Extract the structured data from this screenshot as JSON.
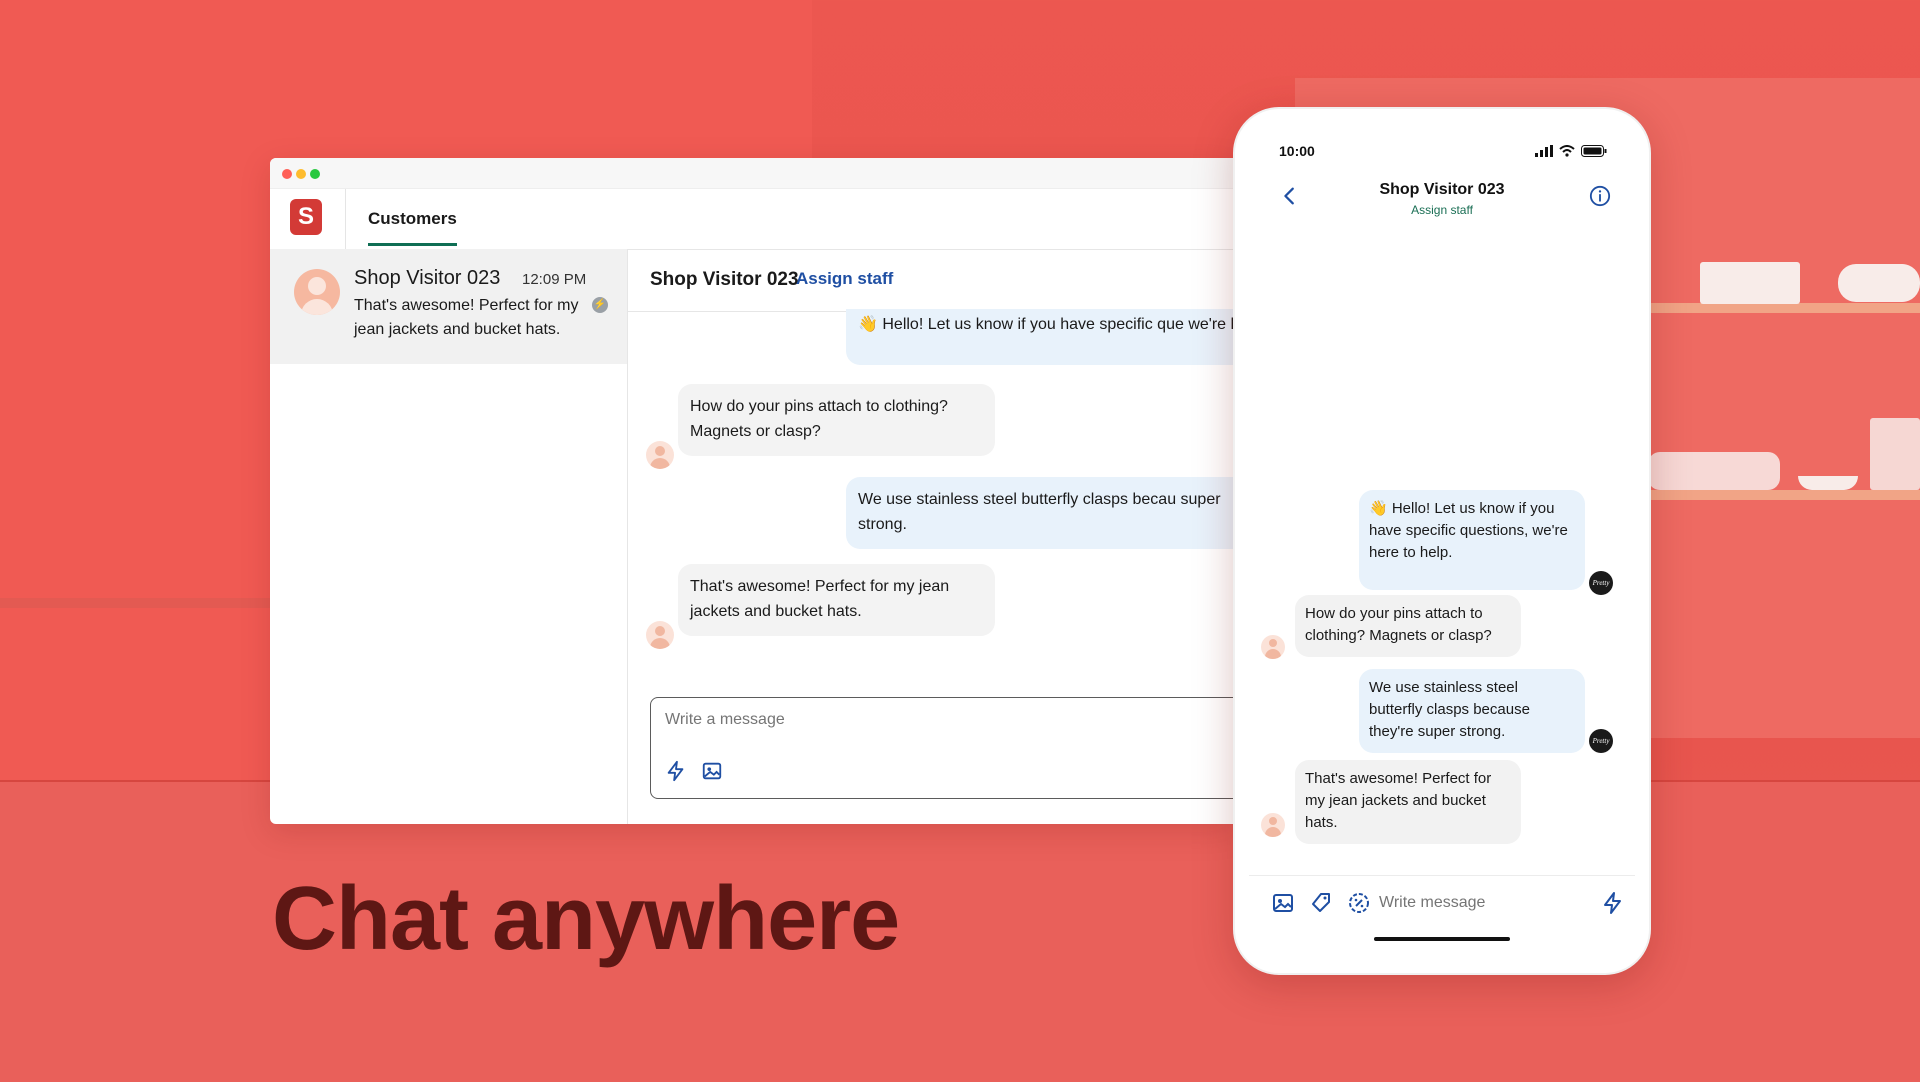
{
  "desktop": {
    "tab_label": "Customers",
    "logo_letter": "S",
    "conversation": {
      "name": "Shop Visitor 023",
      "time": "12:09 PM",
      "preview": "That's awesome! Perfect for my jean jackets and bucket hats."
    },
    "chat": {
      "title": "Shop Visitor 023",
      "assign_label": "Assign staff",
      "messages": [
        {
          "from": "shop",
          "text": "👋 Hello! Let us know if you have specific que we're here to help."
        },
        {
          "from": "visitor",
          "text": "How do your pins attach to clothing? Magnets or clasp?"
        },
        {
          "from": "shop",
          "text": "We use stainless steel butterfly clasps becau super strong."
        },
        {
          "from": "visitor",
          "text": "That's awesome! Perfect for my jean jackets and bucket hats."
        }
      ],
      "composer_placeholder": "Write a message"
    }
  },
  "headline": "Chat anywhere",
  "phone": {
    "time": "10:00",
    "title": "Shop Visitor 023",
    "assign_label": "Assign staff",
    "messages": [
      {
        "from": "shop",
        "text": "👋 Hello! Let us know if you have specific questions, we're here to help."
      },
      {
        "from": "visitor",
        "text": "How do your pins attach to clothing? Magnets or clasp?"
      },
      {
        "from": "shop",
        "text": "We use stainless steel butterfly clasps because they're super strong."
      },
      {
        "from": "visitor",
        "text": "That's awesome! Perfect for my jean jackets and bucket hats."
      }
    ],
    "composer_placeholder": "Write message",
    "shop_avatar_text": "Pretty Pins"
  },
  "colors": {
    "background": "#ec5750",
    "brand_green": "#0f6e54",
    "link_blue": "#1f4fa3",
    "headline": "#5e1714",
    "outgoing_bubble": "#e8f2fb",
    "incoming_bubble": "#f3f3f3"
  }
}
